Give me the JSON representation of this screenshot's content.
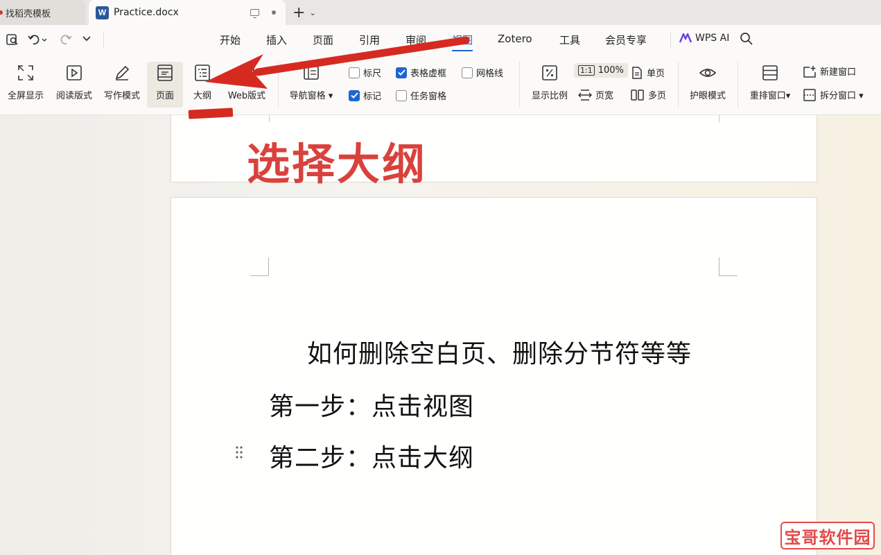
{
  "tabs": [
    {
      "label": "找稻壳模板"
    },
    {
      "label": "Practice.docx",
      "app_icon_letter": "W"
    }
  ],
  "new_tab": {
    "plus": "+",
    "chevron": "⌄"
  },
  "menu": {
    "items": [
      "开始",
      "插入",
      "页面",
      "引用",
      "审阅",
      "视图",
      "Zotero",
      "工具",
      "会员专享"
    ],
    "active": "视图",
    "wps_ai": "WPS AI"
  },
  "ribbon": {
    "fullscreen": "全屏显示",
    "reading": "阅读版式",
    "writing": "写作模式",
    "page": "页面",
    "outline": "大纲",
    "web": "Web版式",
    "nav_pane": "导航窗格",
    "ruler": {
      "label": "标尺",
      "checked": false
    },
    "table_grid": {
      "label": "表格虚框",
      "checked": true
    },
    "gridlines": {
      "label": "网格线",
      "checked": false
    },
    "marks": {
      "label": "标记",
      "checked": true
    },
    "task_pane": {
      "label": "任务窗格",
      "checked": false
    },
    "zoom_ratio": "显示比例",
    "zoom_100": "100%",
    "zoom_100_icon": "1:1",
    "page_width": "页宽",
    "single_page": "单页",
    "multi_page": "多页",
    "eye_care": "护眼模式",
    "rearrange": "重排窗口",
    "new_window": "新建窗口",
    "split_window": "拆分窗口"
  },
  "annotation": {
    "text": "选择大纲",
    "color": "#d9423c"
  },
  "document": {
    "title": "如何删除空白页、删除分节符等等",
    "step1": "第一步：点击视图",
    "step2": "第二步：点击大纲"
  },
  "watermark": "宝哥软件园",
  "colors": {
    "accent": "#1b66d4",
    "annotation_red": "#d62a21"
  }
}
